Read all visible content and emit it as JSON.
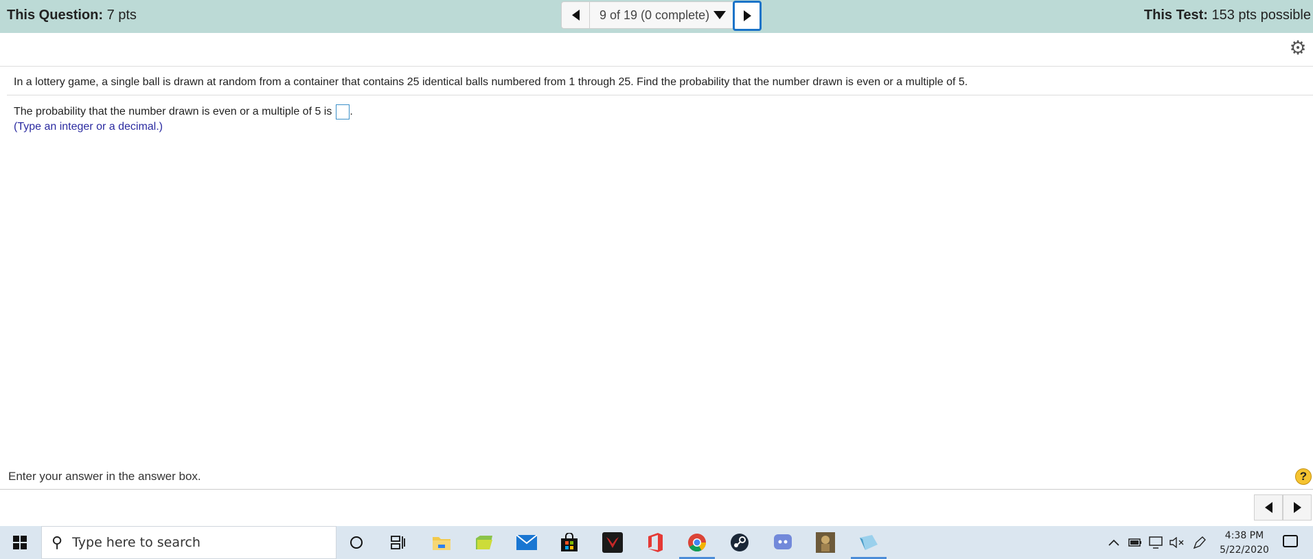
{
  "header": {
    "question_label": "This Question:",
    "question_value": "7 pts",
    "test_label": "This Test:",
    "test_value": "153 pts possible",
    "nav_status": "9 of 19 (0 complete)"
  },
  "question": {
    "text": "In a lottery game, a single ball is drawn at random from a container that contains 25 identical balls numbered from 1 through 25. Find the probability that the number drawn is even or a multiple of 5.",
    "answer_prefix": "The probability that the number drawn is even or a multiple of 5 is",
    "answer_suffix": ".",
    "answer_value": "",
    "hint": "(Type an integer or a decimal.)"
  },
  "footer": {
    "instruction": "Enter your answer in the answer box.",
    "help_label": "?"
  },
  "taskbar": {
    "search_placeholder": "Type here to search",
    "time": "4:38 PM",
    "date": "5/22/2020",
    "apps": [
      "task-view",
      "file-explorer",
      "sticky-folder",
      "mail",
      "store",
      "predator",
      "office",
      "chrome",
      "steam",
      "discord",
      "game",
      "paint"
    ]
  }
}
